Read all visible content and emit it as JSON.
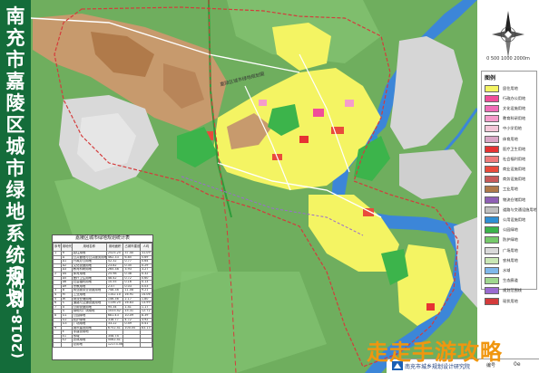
{
  "title": {
    "main": "南充市嘉陵区城市绿地系统规划",
    "years": "(2018-2030)"
  },
  "legend": {
    "title": "图例",
    "items": [
      {
        "label": "居住用地",
        "color": "#f4f463"
      },
      {
        "label": "行政办公用地",
        "color": "#f04d9a"
      },
      {
        "label": "文化设施用地",
        "color": "#f06db8"
      },
      {
        "label": "教育科研用地",
        "color": "#f59ccb"
      },
      {
        "label": "中小学用地",
        "color": "#f4c7d8"
      },
      {
        "label": "体育用地",
        "color": "#d9a5c5"
      },
      {
        "label": "医疗卫生用地",
        "color": "#e63333"
      },
      {
        "label": "社会福利用地",
        "color": "#ee7b7b"
      },
      {
        "label": "商业设施用地",
        "color": "#e94b3c"
      },
      {
        "label": "商务设施用地",
        "color": "#c85a5a"
      },
      {
        "label": "工业用地",
        "color": "#b07a4a"
      },
      {
        "label": "物流仓储用地",
        "color": "#8f5fb5"
      },
      {
        "label": "道路与交通设施用地",
        "color": "#bfbfbf"
      },
      {
        "label": "公用设施用地",
        "color": "#2f8fd3"
      },
      {
        "label": "公园绿地",
        "color": "#3cb44b"
      },
      {
        "label": "防护绿地",
        "color": "#76c96b"
      },
      {
        "label": "广场用地",
        "color": "#d9d9d9"
      },
      {
        "label": "农林用地",
        "color": "#c9e7b5"
      },
      {
        "label": "水域",
        "color": "#7fb8ea"
      },
      {
        "label": "生态廊道",
        "color": "#9fd78f"
      },
      {
        "label": "规划范围线",
        "color": "#9a6bd0"
      },
      {
        "label": "现状用地",
        "color": "#d43b3b"
      }
    ]
  },
  "stats_table": {
    "title": "嘉陵区城市绿地规划统计表",
    "headers": [
      "序号",
      "用地代码",
      "用地名称",
      "用地面积",
      "占城市建设用地",
      "人均"
    ],
    "rows": [
      [
        "1",
        "R",
        "居住用地",
        "2525.25",
        "37.40",
        "31.09"
      ],
      [
        "",
        "A",
        "公共管理与公共服务用地",
        "462.33",
        "6.85",
        "5.69"
      ],
      [
        "",
        "A1",
        "行政办公用地",
        "52.32",
        "0.77",
        "0.64"
      ],
      [
        "",
        "A2",
        "文化设施用地",
        "23.82",
        "0.35",
        "0.29"
      ],
      [
        "",
        "A3",
        "教育科研用地",
        "265.38",
        "3.93",
        "3.27"
      ],
      [
        "2",
        "A4",
        "体育用地",
        "25.98",
        "0.38",
        "0.32"
      ],
      [
        "",
        "A5",
        "医疗卫生用地",
        "48.42",
        "0.72",
        "0.60"
      ],
      [
        "",
        "A6",
        "社会福利用地",
        "10.55",
        "0.16",
        "0.13"
      ],
      [
        "",
        "A9",
        "宗教用地",
        "2.07",
        "0.03",
        "0.03"
      ],
      [
        "3",
        "B",
        "商业服务业设施用地",
        "748.38",
        "11.08",
        "9.21"
      ],
      [
        "4",
        "M",
        "工业用地",
        "1142.10",
        "16.91",
        "14.06"
      ],
      [
        "5",
        "W",
        "物流仓储用地",
        "146.36",
        "2.17",
        "1.80"
      ],
      [
        "6",
        "S",
        "道路与交通设施用地",
        "1136.25",
        "16.83",
        "13.99"
      ],
      [
        "7",
        "U",
        "公用设施用地",
        "95.34",
        "1.41",
        "1.17"
      ],
      [
        "",
        "G",
        "绿地与广场用地",
        "1033.42",
        "15.31",
        "12.72"
      ],
      [
        "8",
        "G1",
        "公园绿地",
        "681.43",
        "10.09",
        "8.39"
      ],
      [
        "",
        "G2",
        "防护绿地",
        "318.77",
        "4.72",
        "3.92"
      ],
      [
        "",
        "G3",
        "广场用地",
        "33.22",
        "0.49",
        "0.41"
      ],
      [
        "9",
        "",
        "城市建设用地",
        "6752.41",
        "100.00",
        "83.13"
      ],
      [
        "",
        "E",
        "非建设用地",
        "",
        "",
        ""
      ],
      [
        "",
        "E1",
        "水域",
        "358.74",
        "",
        ""
      ],
      [
        "",
        "E2",
        "农林用地",
        "5062.41",
        "",
        ""
      ],
      [
        "",
        "",
        "总用地",
        "12173.56",
        "",
        ""
      ]
    ]
  },
  "map_labels": {
    "float_label": "嘉陵区城市绿地规划图"
  },
  "compass": {
    "scale_text": "0 500 1000 2000m"
  },
  "footer": {
    "org_name": "南充市城乡规划设计研究院",
    "page_label": "编号",
    "page_number": "0e"
  },
  "watermark": "走走手游攻略",
  "colors": {
    "title_band": "#146c3a",
    "river": "#3c86d8",
    "residential": "#f4f463",
    "industrial": "#b07a4a",
    "park": "#3cb44b",
    "base_green": "#7fbf6a",
    "boundary": "#d43b3b"
  }
}
